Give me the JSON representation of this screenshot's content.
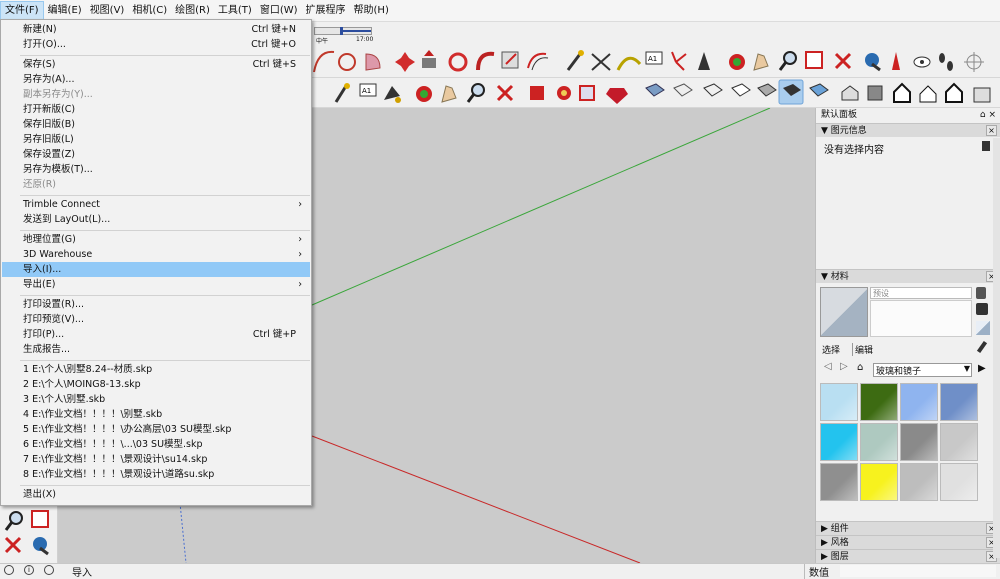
{
  "menubar": {
    "items": [
      "文件(F)",
      "编辑(E)",
      "视图(V)",
      "相机(C)",
      "绘图(R)",
      "工具(T)",
      "窗口(W)",
      "扩展程序",
      "帮助(H)"
    ]
  },
  "file_menu": {
    "items": [
      {
        "label": "新建(N)",
        "shortcut": "Ctrl 键+N"
      },
      {
        "label": "打开(O)...",
        "shortcut": "Ctrl 键+O"
      },
      {
        "label": "保存(S)",
        "shortcut": "Ctrl 键+S"
      },
      {
        "label": "另存为(A)..."
      },
      {
        "label": "副本另存为(Y)...",
        "disabled": true
      },
      {
        "label": "打开新版(C)"
      },
      {
        "label": "保存旧版(B)"
      },
      {
        "label": "另存旧版(L)"
      },
      {
        "label": "保存设置(Z)"
      },
      {
        "label": "另存为模板(T)..."
      },
      {
        "label": "还原(R)",
        "disabled": true
      },
      {
        "label": "Trimble Connect",
        "submenu": true
      },
      {
        "label": "发送到 LayOut(L)..."
      },
      {
        "label": "地理位置(G)",
        "submenu": true
      },
      {
        "label": "3D Warehouse",
        "submenu": true
      },
      {
        "label": "导入(I)...",
        "highlighted": true
      },
      {
        "label": "导出(E)",
        "submenu": true
      },
      {
        "label": "打印设置(R)..."
      },
      {
        "label": "打印预览(V)..."
      },
      {
        "label": "打印(P)...",
        "shortcut": "Ctrl 键+P"
      },
      {
        "label": "生成报告..."
      },
      {
        "label": "1 E:\\个人\\别墅8.24--材质.skp"
      },
      {
        "label": "2 E:\\个人\\MOING8-13.skp"
      },
      {
        "label": "3 E:\\个人\\别墅.skb"
      },
      {
        "label": "4 E:\\作业文档！！！！\\别墅.skb"
      },
      {
        "label": "5 E:\\作业文档！！！！\\办公高层\\03  SU模型.skp"
      },
      {
        "label": "6 E:\\作业文档！！！！\\...\\03  SU模型.skp"
      },
      {
        "label": "7 E:\\作业文档！！！！\\景观设计\\su14.skp"
      },
      {
        "label": "8 E:\\作业文档！！！！\\景观设计\\道路su.skp"
      },
      {
        "label": "退出(X)"
      }
    ]
  },
  "shadow_bar": {
    "label_noon": "中午",
    "label_time": "17:00"
  },
  "tray": {
    "title": "默认面板",
    "entity_info": {
      "title": "图元信息",
      "status": "没有选择内容"
    },
    "materials": {
      "title": "材料",
      "preset_placeholder": "预设",
      "tab_select": "选择",
      "tab_edit": "编辑",
      "library": "玻璃和镜子",
      "swatch_colors": [
        "#b9dff2",
        "#3d6b12",
        "#8fb4ef",
        "#6f8fc8",
        "#23c3ee",
        "#aec9c0",
        "#8a8a8a",
        "#c8c8c8",
        "#8f8f8f",
        "#f7f21e",
        "#bdbdbd",
        "#e0e0e0"
      ]
    },
    "components_title": "组件",
    "styles_title": "风格",
    "layers_title": "图层"
  },
  "statusbar": {
    "hint": "导入",
    "measure_label": "数值"
  },
  "axes_colors": {
    "green": "#3aa63a",
    "red": "#c82828",
    "blue": "#4a6fd0"
  }
}
